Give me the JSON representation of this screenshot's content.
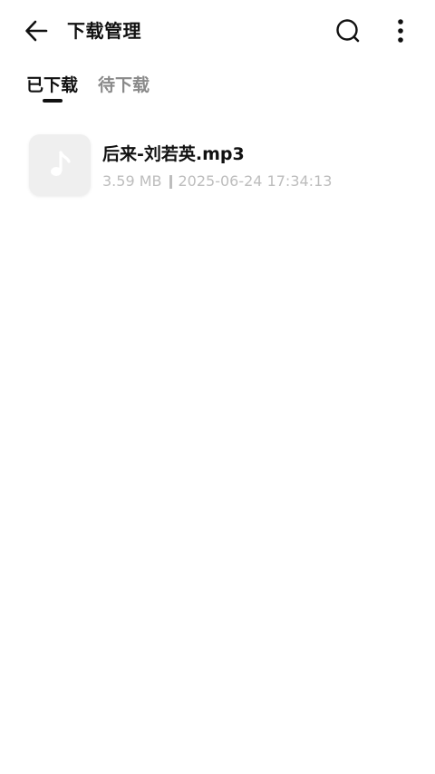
{
  "header": {
    "title": "下载管理",
    "back_icon": "arrow-left-icon",
    "search_icon": "search-icon",
    "more_icon": "more-vertical-icon"
  },
  "tabs": [
    {
      "label": "已下载",
      "active": true
    },
    {
      "label": "待下载",
      "active": false
    }
  ],
  "downloads": [
    {
      "name": "后来-刘若英.mp3",
      "size": "3.59 MB",
      "timestamp": "2025-06-24 17:34:13",
      "icon": "music-note-icon"
    }
  ],
  "colors": {
    "primary_text": "#111111",
    "inactive_tab": "#8a8a8a",
    "meta_text": "#bdbdbd",
    "thumb_bg": "#efefef"
  }
}
